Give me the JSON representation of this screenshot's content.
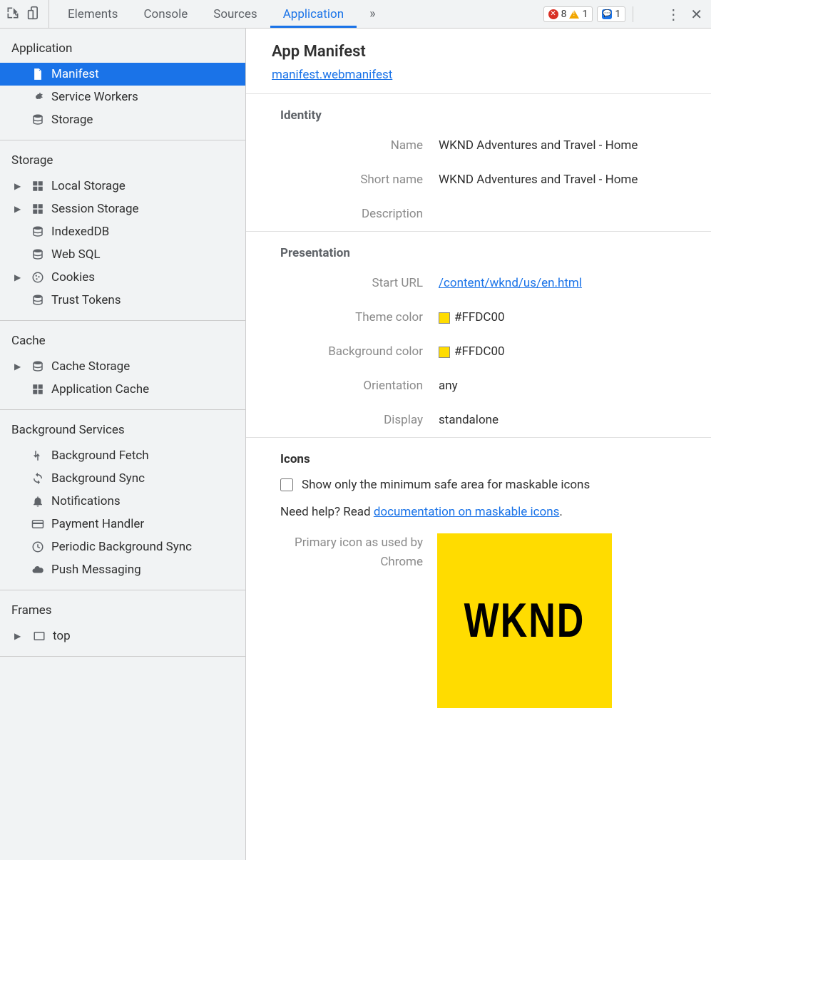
{
  "topbar": {
    "tabs": [
      "Elements",
      "Console",
      "Sources",
      "Application"
    ],
    "active_tab_index": 3,
    "errors_count": "8",
    "warnings_count": "1",
    "info_count": "1"
  },
  "sidebar": {
    "sections": [
      {
        "heading": "Application",
        "items": [
          {
            "icon": "file",
            "label": "Manifest",
            "selected": true
          },
          {
            "icon": "gear",
            "label": "Service Workers"
          },
          {
            "icon": "db",
            "label": "Storage"
          }
        ]
      },
      {
        "heading": "Storage",
        "items": [
          {
            "icon": "grid",
            "label": "Local Storage",
            "expandable": true
          },
          {
            "icon": "grid",
            "label": "Session Storage",
            "expandable": true
          },
          {
            "icon": "db",
            "label": "IndexedDB"
          },
          {
            "icon": "db",
            "label": "Web SQL"
          },
          {
            "icon": "cookie",
            "label": "Cookies",
            "expandable": true
          },
          {
            "icon": "db",
            "label": "Trust Tokens"
          }
        ]
      },
      {
        "heading": "Cache",
        "items": [
          {
            "icon": "db",
            "label": "Cache Storage",
            "expandable": true
          },
          {
            "icon": "grid",
            "label": "Application Cache"
          }
        ]
      },
      {
        "heading": "Background Services",
        "items": [
          {
            "icon": "fetch",
            "label": "Background Fetch"
          },
          {
            "icon": "sync",
            "label": "Background Sync"
          },
          {
            "icon": "bell",
            "label": "Notifications"
          },
          {
            "icon": "card",
            "label": "Payment Handler"
          },
          {
            "icon": "clock",
            "label": "Periodic Background Sync"
          },
          {
            "icon": "cloud",
            "label": "Push Messaging"
          }
        ]
      },
      {
        "heading": "Frames",
        "items": [
          {
            "icon": "frame",
            "label": "top",
            "expandable": true
          }
        ]
      }
    ]
  },
  "main": {
    "title": "App Manifest",
    "manifest_link": "manifest.webmanifest",
    "identity": {
      "heading": "Identity",
      "name_label": "Name",
      "name_value": "WKND Adventures and Travel - Home",
      "short_name_label": "Short name",
      "short_name_value": "WKND Adventures and Travel - Home",
      "description_label": "Description",
      "description_value": ""
    },
    "presentation": {
      "heading": "Presentation",
      "start_url_label": "Start URL",
      "start_url_value": "/content/wknd/us/en.html",
      "theme_color_label": "Theme color",
      "theme_color_value": "#FFDC00",
      "bg_color_label": "Background color",
      "bg_color_value": "#FFDC00",
      "orientation_label": "Orientation",
      "orientation_value": "any",
      "display_label": "Display",
      "display_value": "standalone"
    },
    "icons": {
      "heading": "Icons",
      "checkbox_label": "Show only the minimum safe area for maskable icons",
      "help_prefix": "Need help? Read ",
      "help_link": "documentation on maskable icons",
      "help_suffix": ".",
      "primary_label_line1": "Primary icon as used by",
      "primary_label_line2": "Chrome",
      "icon_text": "WKND",
      "icon_bg": "#FFDC00"
    }
  }
}
